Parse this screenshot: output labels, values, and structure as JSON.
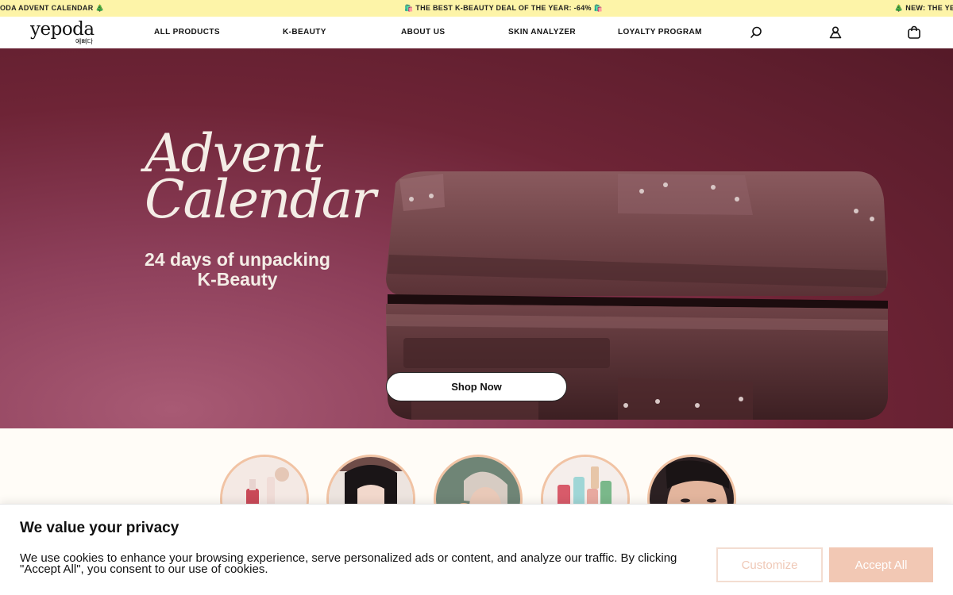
{
  "announcement": {
    "left": "ODA ADVENT CALENDAR 🎄",
    "center": "🛍️ THE BEST K-BEAUTY DEAL OF THE YEAR: -64% 🛍️",
    "right": "🎄 NEW: THE YEP"
  },
  "logo": {
    "main": "yepoda",
    "sub": "예뻐다"
  },
  "nav": [
    "ALL PRODUCTS",
    "K-BEAUTY",
    "ABOUT US",
    "SKIN ANALYZER",
    "LOYALTY PROGRAM"
  ],
  "icons": {
    "search": "search-icon",
    "account": "user-icon",
    "cart": "shopping-bag-icon"
  },
  "hero": {
    "title_line1": "Advent",
    "title_line2": "Calendar",
    "subtitle_line1": "24 days of unpacking",
    "subtitle_line2": "K-Beauty",
    "cta": "Shop Now"
  },
  "categories": [
    {
      "icon": "serum-bottles-image"
    },
    {
      "icon": "smiling-woman-image"
    },
    {
      "icon": "woman-with-headband-image"
    },
    {
      "icon": "product-bottles-image"
    },
    {
      "icon": "face-closeup-image"
    }
  ],
  "cookie": {
    "title": "We value your privacy",
    "text": "We use cookies to enhance your browsing experience, serve personalized ads or content, and analyze our traffic. By clicking \"Accept All\", you consent to our use of cookies.",
    "customize": "Customize",
    "accept": "Accept All"
  },
  "colors": {
    "announcement_bg": "#fdf4a8",
    "hero_bg": "#6e2436",
    "accent": "#f2c8b4",
    "circle_border": "#f1c3a4"
  }
}
